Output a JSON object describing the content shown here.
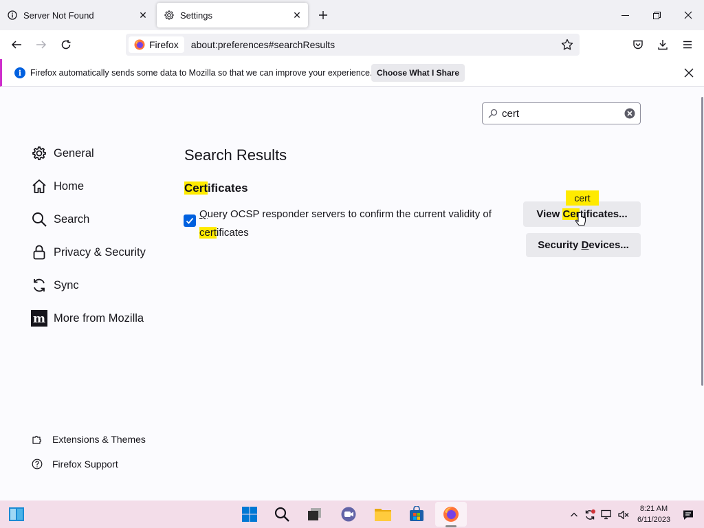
{
  "tabs": [
    {
      "title": "Server Not Found",
      "icon": "info-icon",
      "active": false
    },
    {
      "title": "Settings",
      "icon": "gear-icon",
      "active": true
    }
  ],
  "window_controls": {
    "minimize": "minimize-icon",
    "maximize": "restore-icon",
    "close": "close-icon"
  },
  "navbar": {
    "identity_label": "Firefox",
    "url": "about:preferences#searchResults"
  },
  "notification": {
    "text": "Firefox automatically sends some data to Mozilla so that we can improve your experience.",
    "button": "Choose What I Share"
  },
  "search": {
    "value": "cert"
  },
  "sidebar": {
    "items": [
      {
        "label": "General",
        "icon": "gear-icon"
      },
      {
        "label": "Home",
        "icon": "home-icon"
      },
      {
        "label": "Search",
        "icon": "search-icon"
      },
      {
        "label": "Privacy & Security",
        "icon": "lock-icon"
      },
      {
        "label": "Sync",
        "icon": "sync-icon"
      },
      {
        "label": "More from Mozilla",
        "icon": "mozilla-icon"
      }
    ],
    "footer": [
      {
        "label": "Extensions & Themes",
        "icon": "puzzle-icon"
      },
      {
        "label": "Firefox Support",
        "icon": "help-icon"
      }
    ]
  },
  "main": {
    "heading": "Search Results",
    "section_title_hl": "Cert",
    "section_title_rest": "ificates",
    "ocsp": {
      "checked": true,
      "label_q": "Q",
      "label_rest": "uery OCSP responder servers to confirm the current validity of",
      "label_hl": "cert",
      "label_tail": "ificates"
    },
    "buttons": {
      "view_cert_pre": "View ",
      "view_cert_hl": "Cer",
      "view_cert_post": "tificates...",
      "security_devices_pre": "Security ",
      "security_devices_u": "D",
      "security_devices_post": "evices..."
    },
    "tooltip": "cert"
  },
  "taskbar": {
    "clock_time": "8:21 AM",
    "clock_date": "6/11/2023",
    "accent": "#f3dde9"
  }
}
